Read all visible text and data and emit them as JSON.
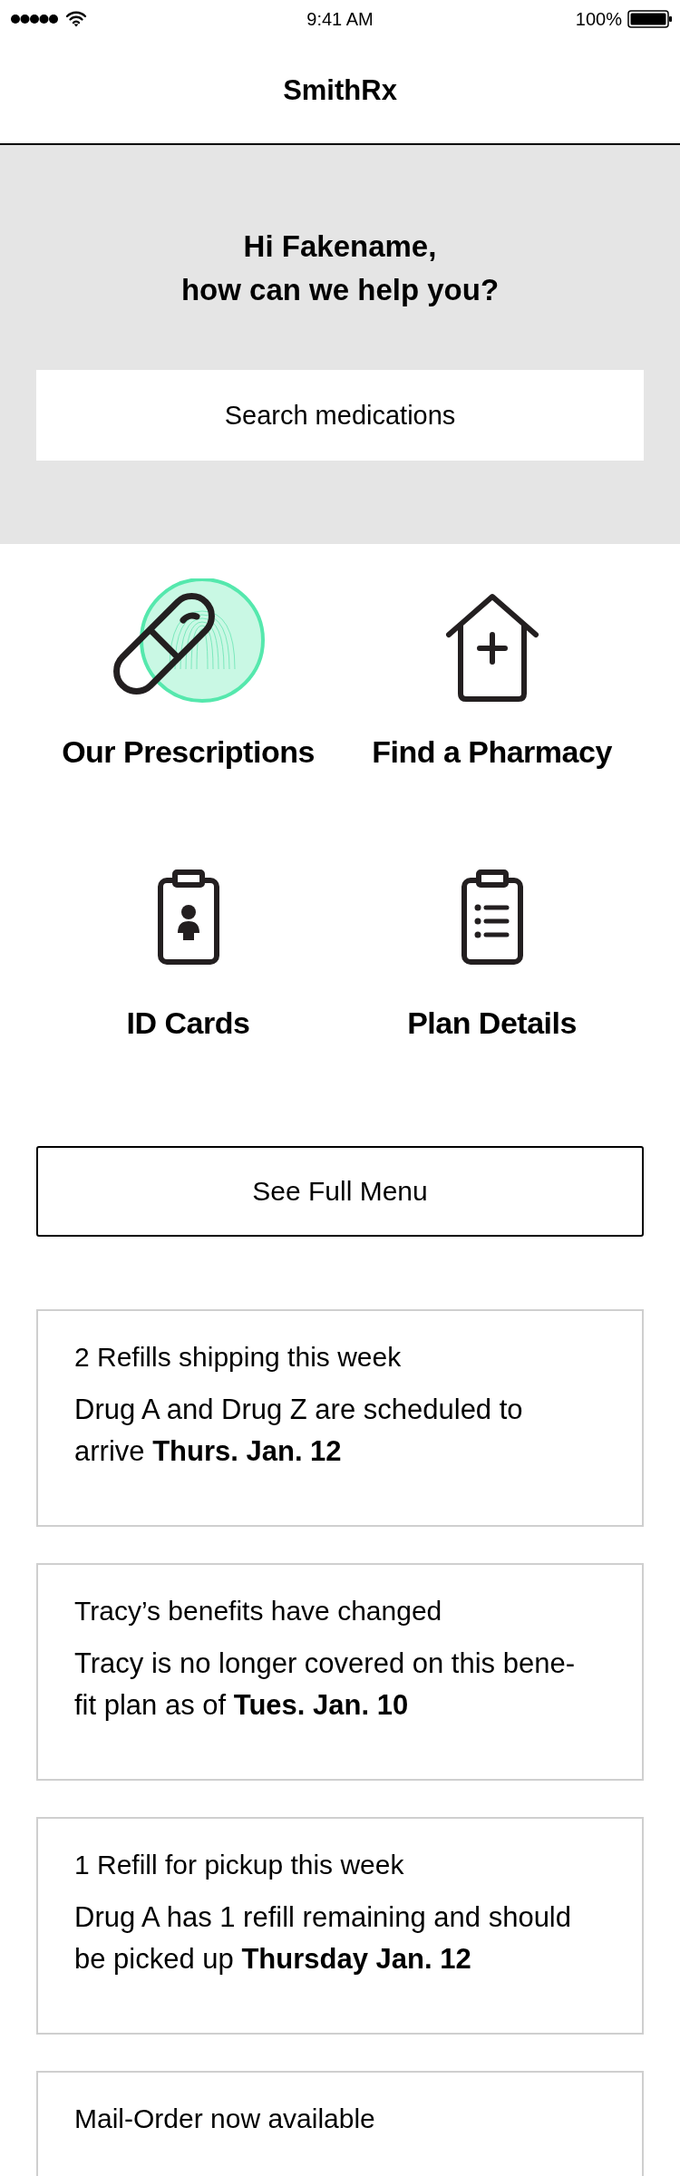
{
  "status_bar": {
    "time": "9:41 AM",
    "battery": "100%"
  },
  "header": {
    "title": "SmithRx"
  },
  "hero": {
    "greeting": "Hi Fakename,",
    "question": "how can we help you?",
    "search": {
      "placeholder": "Search medications"
    }
  },
  "shortcuts": [
    {
      "kind": "pill",
      "label": "Our Prescriptions",
      "touched": true
    },
    {
      "kind": "pharmacy",
      "label": "Find a Pharmacy",
      "touched": false
    },
    {
      "kind": "idcard",
      "label": "ID Cards",
      "touched": false
    },
    {
      "kind": "plan",
      "label": "Plan Details",
      "touched": false
    }
  ],
  "menu_button": "See Full Menu",
  "cards": [
    {
      "title": "2 Refills shipping this week",
      "body": "Drug A and Drug Z are scheduled to arrive **Thurs. Jan. 12**"
    },
    {
      "title": "Tracy’s benefits have changed",
      "body": "Tracy is no longer covered on this bene-fit plan as of **Tues. Jan. 10**"
    },
    {
      "title": "1 Refill for pickup this week",
      "body": "Drug A has 1 refill remaining and should be picked up **Thursday Jan. 12**"
    },
    {
      "title": "Mail-Order now available"
    }
  ]
}
